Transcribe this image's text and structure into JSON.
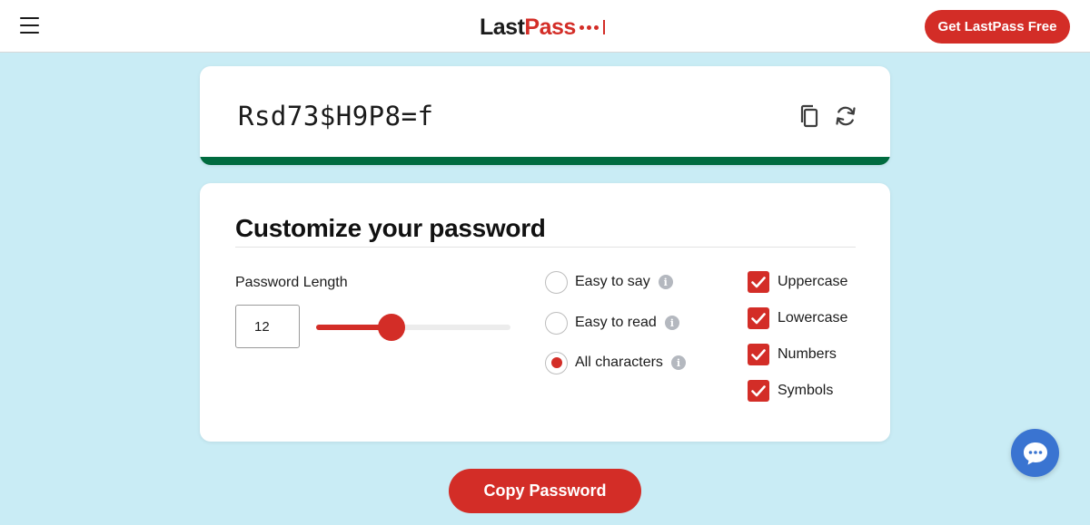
{
  "header": {
    "logo_first": "Last",
    "logo_second": "Pass",
    "cta_label": "Get LastPass Free"
  },
  "password": {
    "value": "Rsd73$H9P8=f",
    "strength_color": "#006b3f"
  },
  "customize": {
    "title": "Customize your password",
    "length_label": "Password Length",
    "length_value": "12",
    "slider": {
      "min": 4,
      "max": 50,
      "value": 12
    },
    "radios": [
      {
        "label": "Easy to say",
        "selected": false
      },
      {
        "label": "Easy to read",
        "selected": false
      },
      {
        "label": "All characters",
        "selected": true
      }
    ],
    "checkboxes": [
      {
        "label": "Uppercase",
        "checked": true
      },
      {
        "label": "Lowercase",
        "checked": true
      },
      {
        "label": "Numbers",
        "checked": true
      },
      {
        "label": "Symbols",
        "checked": true
      }
    ]
  },
  "footer": {
    "copy_label": "Copy Password"
  },
  "colors": {
    "brand": "#d32d27",
    "background": "#c9ecf5",
    "chat": "#3a74d1"
  },
  "icons": {
    "menu": "hamburger-menu-icon",
    "copy": "copy-icon",
    "regenerate": "refresh-icon",
    "info": "info-icon",
    "check": "checkmark-icon",
    "chat": "chat-bubble-icon"
  }
}
